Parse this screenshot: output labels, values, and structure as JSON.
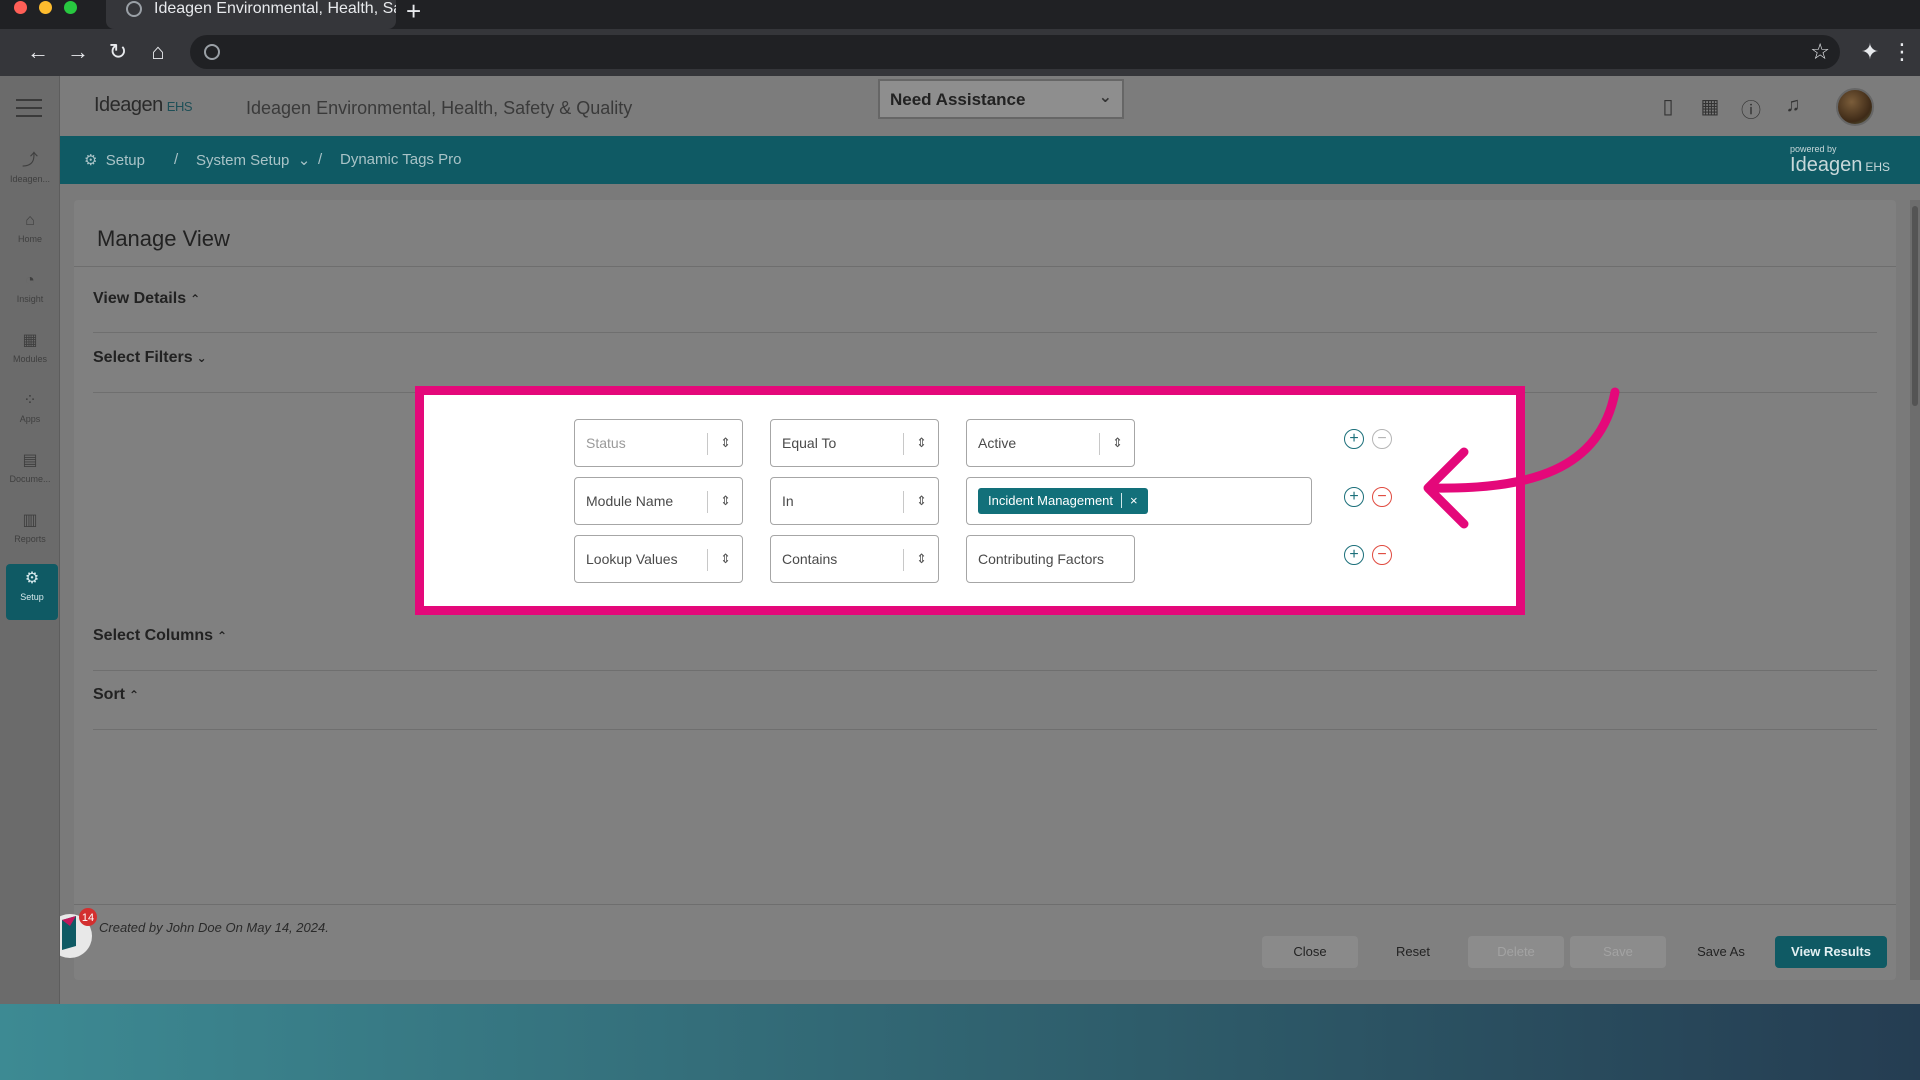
{
  "browser": {
    "tab_title": "Ideagen Environmental, Health, Sa",
    "new_tab": "+"
  },
  "app": {
    "logo": "Ideagen",
    "logo_suffix": "EHS",
    "title": "Ideagen Environmental, Health, Safety & Quality",
    "assist_label": "Need Assistance",
    "breadcrumb": [
      "Setup",
      "System Setup",
      "Dynamic Tags Pro"
    ],
    "powered_by": "powered by",
    "powered_logo": "Ideagen",
    "powered_suffix": "EHS"
  },
  "leftnav": [
    {
      "label": "Ideagen...",
      "icon": "ideagen-icon",
      "glyph": "⤴"
    },
    {
      "label": "Home",
      "icon": "home-icon",
      "glyph": "⌂"
    },
    {
      "label": "Insight",
      "icon": "insight-icon",
      "glyph": "◔"
    },
    {
      "label": "Modules",
      "icon": "modules-icon",
      "glyph": "▦"
    },
    {
      "label": "Apps",
      "icon": "apps-icon",
      "glyph": "⁘"
    },
    {
      "label": "Docume...",
      "icon": "document-icon",
      "glyph": "▤"
    },
    {
      "label": "Reports",
      "icon": "reports-icon",
      "glyph": "▥"
    },
    {
      "label": "Setup",
      "icon": "gear-icon",
      "glyph": "⚙"
    }
  ],
  "page": {
    "title": "Manage View",
    "sections": {
      "view_details": "View Details",
      "select_filters": "Select Filters",
      "select_columns": "Select Columns",
      "sort": "Sort"
    },
    "created": "Created by John Doe On May 14, 2024.",
    "buttons": {
      "close": "Close",
      "reset": "Reset",
      "delete": "Delete",
      "save": "Save",
      "save_as": "Save As",
      "view_results": "View Results"
    },
    "notification_count": "14"
  },
  "filters": [
    {
      "field": "Status",
      "operator": "Equal To",
      "value": "Active"
    },
    {
      "field": "Module Name",
      "operator": "In",
      "value_tag": "Incident Management"
    },
    {
      "field": "Lookup Values",
      "operator": "Contains",
      "value": "Contributing Factors"
    }
  ],
  "colors": {
    "brand": "#0f5a64",
    "highlight": "#e4087a"
  }
}
